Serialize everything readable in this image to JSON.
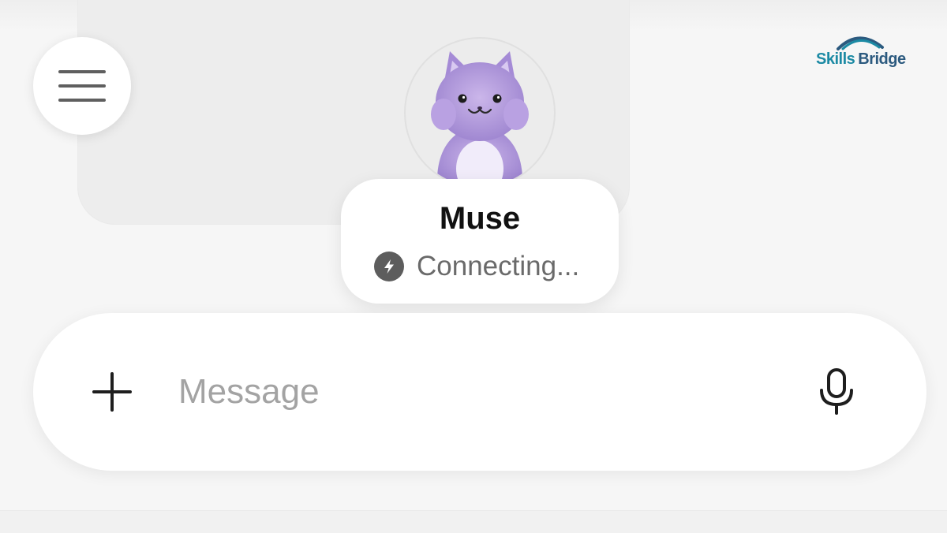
{
  "logo": {
    "word1": "Skills",
    "word2": "Bridge",
    "colors": {
      "primary": "#1c8aa4",
      "secondary": "#2c5a7f"
    }
  },
  "menu": {
    "icon": "hamburger-menu-icon"
  },
  "agent": {
    "name": "Muse",
    "status": "Connecting...",
    "status_icon": "lightning-bolt-icon",
    "avatar": "purple-cat-avatar"
  },
  "composer": {
    "placeholder": "Message",
    "value": "",
    "add_icon": "plus-icon",
    "mic_icon": "microphone-icon"
  }
}
